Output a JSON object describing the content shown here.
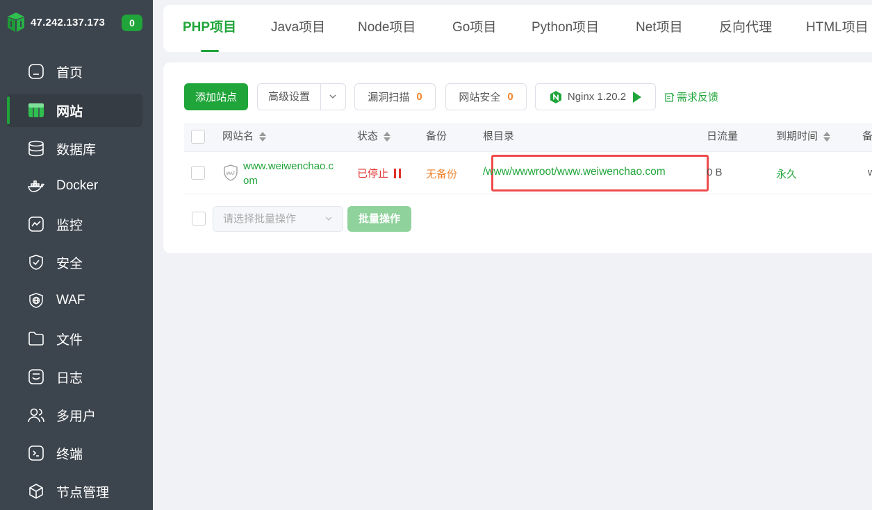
{
  "sidebar": {
    "server_ip": "47.242.137.173",
    "badge_count": "0",
    "items": [
      {
        "label": "首页",
        "icon": "home-icon"
      },
      {
        "label": "网站",
        "icon": "website-icon",
        "active": true
      },
      {
        "label": "数据库",
        "icon": "database-icon"
      },
      {
        "label": "Docker",
        "icon": "docker-icon"
      },
      {
        "label": "监控",
        "icon": "monitor-icon"
      },
      {
        "label": "安全",
        "icon": "shield-icon"
      },
      {
        "label": "WAF",
        "icon": "waf-icon"
      },
      {
        "label": "文件",
        "icon": "folder-icon"
      },
      {
        "label": "日志",
        "icon": "log-icon"
      },
      {
        "label": "多用户",
        "icon": "users-icon"
      },
      {
        "label": "终端",
        "icon": "terminal-icon"
      },
      {
        "label": "节点管理",
        "icon": "node-icon"
      }
    ]
  },
  "tabs": [
    "PHP项目",
    "Java项目",
    "Node项目",
    "Go项目",
    "Python项目",
    "Net项目",
    "反向代理",
    "HTML项目"
  ],
  "active_tab": "PHP项目",
  "toolbar": {
    "add_site": "添加站点",
    "advanced": "高级设置",
    "vuln_scan": "漏洞扫描",
    "vuln_count": "0",
    "site_security": "网站安全",
    "security_count": "0",
    "nginx": "Nginx 1.20.2",
    "feedback": "需求反馈"
  },
  "table": {
    "columns": [
      "网站名",
      "状态",
      "备份",
      "根目录",
      "日流量",
      "到期时间",
      "备"
    ],
    "rows": [
      {
        "name_line1": "www.weiwenchao.c",
        "name_line2": "om",
        "status": "已停止",
        "backup": "无备份",
        "root": "/www/wwwroot/www.weiwenchao.com",
        "traffic": "0 B",
        "expire": "永久",
        "note": "w",
        "waf_label": "WAF"
      }
    ]
  },
  "batch": {
    "placeholder": "请选择批量操作",
    "button": "批量操作"
  },
  "colors": {
    "accent": "#20a53a",
    "sidebar_bg": "#3c444d",
    "stopped": "#e0312b",
    "warning": "#f0832c",
    "highlight": "#ef4b4b"
  }
}
